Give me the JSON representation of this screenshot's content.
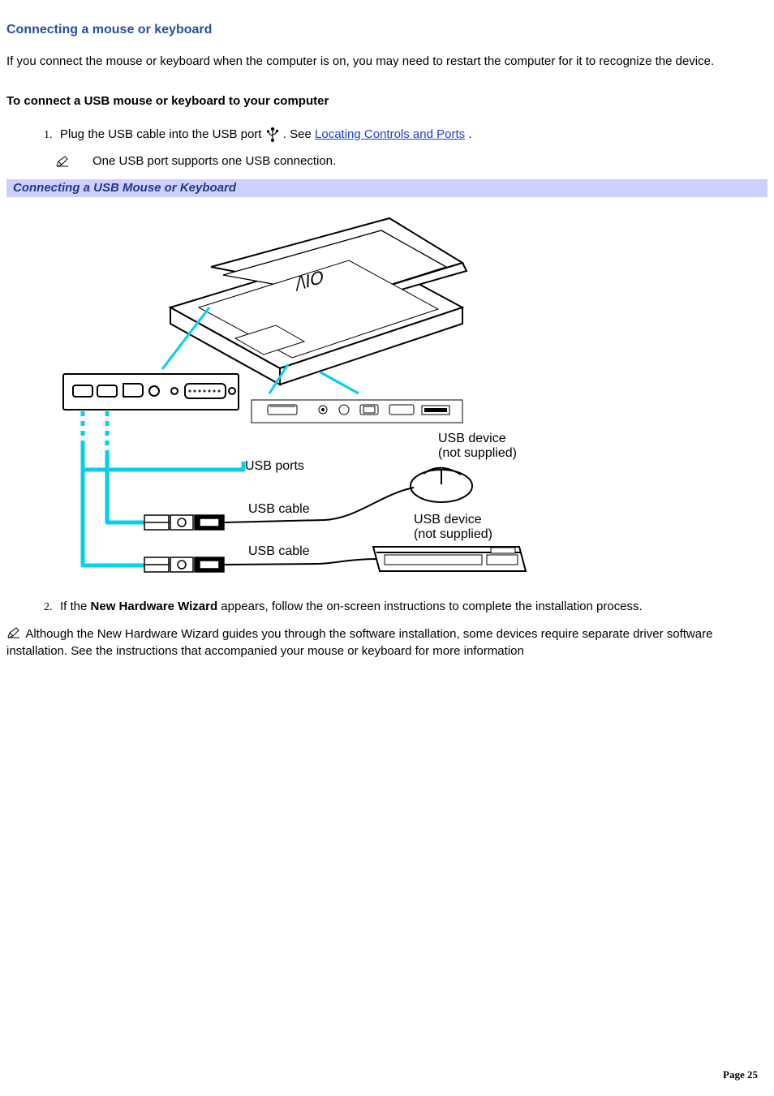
{
  "heading": "Connecting a mouse or keyboard",
  "intro": "If you connect the mouse or keyboard when the computer is on, you may need to restart the computer for it to recognize the device.",
  "subheading": "To connect a USB mouse or keyboard to your computer",
  "step1_pre": "Plug the USB cable into the USB port ",
  "step1_post_prefix": ". See ",
  "step1_link_text": "Locating Controls and Ports",
  "step1_post_suffix": ".",
  "note1": "One USB port supports one USB connection.",
  "figure_caption": "Connecting a USB Mouse or Keyboard",
  "figure_labels": {
    "usb_ports": "USB ports",
    "usb_cable": "USB cable",
    "usb_device": "USB device",
    "not_supplied": "(not supplied)"
  },
  "step2_pre": "If the ",
  "step2_bold": "New Hardware Wizard",
  "step2_post": " appears, follow the on-screen instructions to complete the installation process.",
  "closing_note": " Although the New Hardware Wizard guides you through the software installation, some devices require separate driver software installation. See the instructions that accompanied your mouse or keyboard for more information",
  "page_number": "Page 25"
}
